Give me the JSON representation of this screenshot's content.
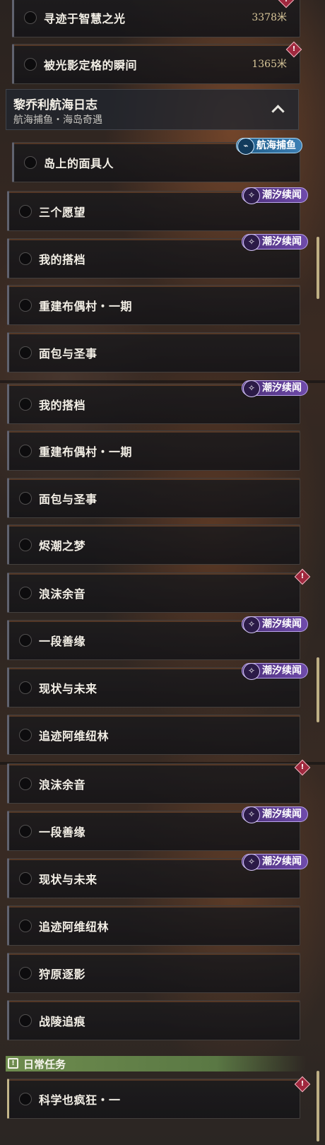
{
  "segment1": {
    "top_quests": [
      {
        "label": "寻迹于智慧之光",
        "distance": "3378米"
      },
      {
        "label": "被光影定格的瞬间",
        "distance": "1365米"
      }
    ],
    "category": {
      "title": "黎乔利航海日志",
      "subtitle": "航海捕鱼・海岛奇遇"
    },
    "quests": [
      {
        "label": "岛上的面具人",
        "badge": "航海捕鱼"
      },
      {
        "label": "三个愿望",
        "badge": "潮汐续闻"
      },
      {
        "label": "我的搭档",
        "badge": "潮汐续闻"
      },
      {
        "label": "重建布偶村・一期"
      },
      {
        "label": "面包与圣事"
      }
    ]
  },
  "segment2": {
    "quests": [
      {
        "label": "我的搭档",
        "badge": "潮汐续闻"
      },
      {
        "label": "重建布偶村・一期"
      },
      {
        "label": "面包与圣事"
      },
      {
        "label": "烬潮之梦"
      },
      {
        "label": "浪沫余音"
      },
      {
        "label": "一段善缘",
        "badge": "潮汐续闻"
      },
      {
        "label": "现状与未来",
        "badge": "潮汐续闻"
      },
      {
        "label": "追迹阿维纽林"
      }
    ]
  },
  "segment3": {
    "quests": [
      {
        "label": "浪沫余音"
      },
      {
        "label": "一段善缘",
        "badge": "潮汐续闻"
      },
      {
        "label": "现状与未来",
        "badge": "潮汐续闻"
      },
      {
        "label": "追迹阿维纽林"
      },
      {
        "label": "狩原逐影"
      },
      {
        "label": "战陵追痕"
      }
    ],
    "daily": {
      "title": "日常任务",
      "icon_glyph": "!"
    },
    "daily_quests": [
      {
        "label": "科学也疯狂・一"
      }
    ]
  },
  "icons": {
    "alert": "alert-diamond-icon",
    "tide_badge": "tide-wave-icon",
    "sea_badge": "fishing-icon",
    "collapse": "chevron-up-icon"
  },
  "colors": {
    "tide_badge": "#6f4bab",
    "sea_badge": "#3c7fb4",
    "alert": "#a0283e",
    "daily_header": "#6e8c4e",
    "distance_text": "#d9c79a"
  }
}
